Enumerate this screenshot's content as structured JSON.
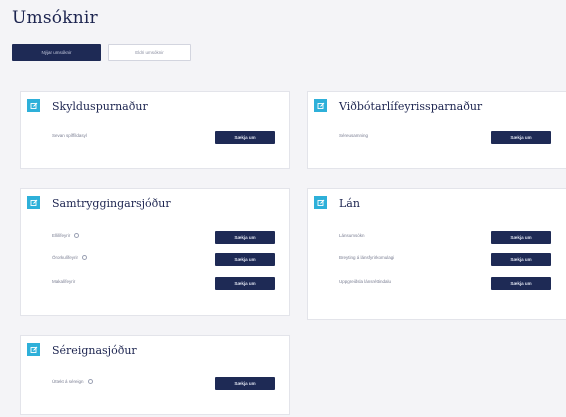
{
  "page": {
    "title": "Umsóknir"
  },
  "tabs": [
    {
      "label": "Nýjar umsóknir",
      "active": true
    },
    {
      "label": "Eldri umsóknir",
      "active": false
    }
  ],
  "cards": [
    {
      "title": "Skylduspurnaður",
      "rows": [
        {
          "label": "Sevan spíffildasyl",
          "info": false,
          "button": "Sækja um"
        }
      ]
    },
    {
      "title": "Viðbótarlífeyrissparnaður",
      "rows": [
        {
          "label": "Séreusamning",
          "info": false,
          "button": "Sækja um"
        }
      ]
    },
    {
      "title": "Samtryggingarsjóður",
      "rows": [
        {
          "label": "Ellilífeyrir",
          "info": true,
          "button": "Sækja um"
        },
        {
          "label": "Örorkulífeyrir",
          "info": true,
          "button": "Sækja um"
        },
        {
          "label": "Makalífeyrir",
          "info": false,
          "button": "Sækja um"
        }
      ]
    },
    {
      "title": "Lán",
      "rows": [
        {
          "label": "Lánsumsókn",
          "info": false,
          "button": "Sækja um"
        },
        {
          "label": "Breyting á lánsfyrirkomulagi",
          "info": false,
          "button": "Sækja um"
        },
        {
          "label": "Uppgreiðsla lánsréttindalu",
          "info": false,
          "button": "Sækja um"
        }
      ]
    },
    {
      "title": "Séreignasjóður",
      "rows": [
        {
          "label": "Úttekt á séreign",
          "info": true,
          "button": "Sækja um"
        }
      ]
    }
  ],
  "colors": {
    "accent": "#2eb0d9",
    "navy": "#1e2a55",
    "frame": "#d9dcec"
  }
}
